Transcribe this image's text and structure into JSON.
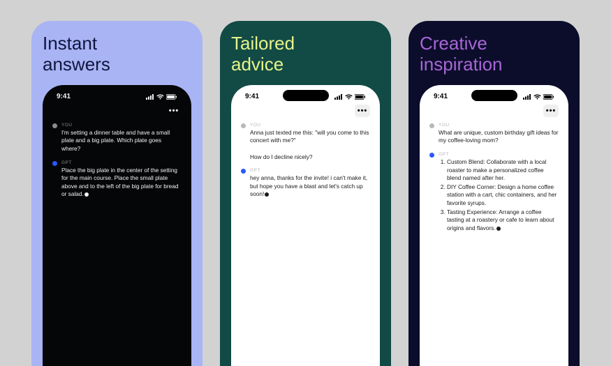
{
  "status_time": "9:41",
  "menu_dots": "•••",
  "role_you": "YOU",
  "role_gpt": "GPT",
  "panels": [
    {
      "title": "Instant\nanswers",
      "user_msg": "I'm setting a dinner table and have a small plate and a big plate. Which plate goes where?",
      "gpt_msg": "Place the big plate in the center of the setting for the main course. Place the small plate above and to the left of the big plate for bread or salad."
    },
    {
      "title": "Tailored\nadvice",
      "user_msg": "Anna just texted me this: \"will you come to this concert with me?\"\n\nHow do I decline nicely?",
      "gpt_msg": "hey anna, thanks for the invite! i can't make it, but hope you have a blast and let's catch up soon!"
    },
    {
      "title": "Creative\ninspiration",
      "user_msg": "What are unique, custom birthday gift ideas for my coffee-loving mom?",
      "gpt_items": [
        "Custom Blend: Collaborate with a local roaster to make a personalized coffee blend named after her.",
        "DIY Coffee Corner: Design a home coffee station with a cart, chic containers, and her favorite syrups.",
        "Tasting Experience: Arrange a coffee tasting at a roastery or cafe to learn about origins and flavors."
      ]
    }
  ]
}
